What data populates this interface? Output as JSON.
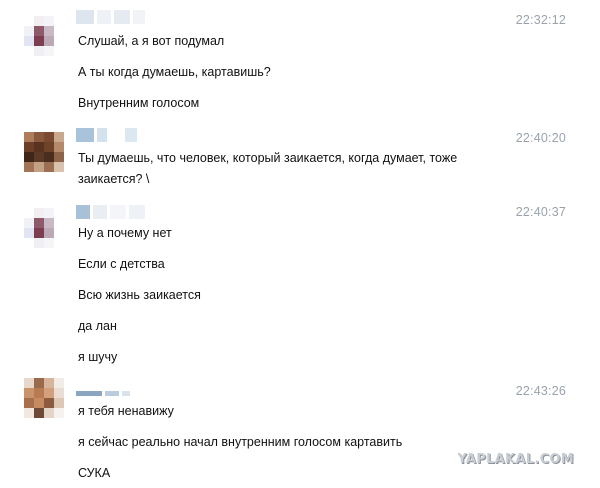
{
  "chat": {
    "messages": [
      {
        "time": "22:32:12",
        "lines": [
          "Слушай, а я вот подумал",
          "А ты когда думаешь, картавишь?",
          "Внутренним голосом"
        ]
      },
      {
        "time": "22:40:20",
        "lines": [
          "Ты думаешь, что человек, который заикается, когда думает, тоже",
          "заикается? \\"
        ]
      },
      {
        "time": "22:40:37",
        "lines": [
          "Ну а почему нет",
          "Если с детства",
          "Всю жизнь заикается",
          "да лан",
          "я шучу"
        ]
      },
      {
        "time": "22:43:26",
        "lines": [
          "я тебя ненавижу",
          "я сейчас реально начал внутренним голосом картавить",
          "СУКА"
        ]
      }
    ]
  },
  "watermark": "YAPLAKAL.COM"
}
